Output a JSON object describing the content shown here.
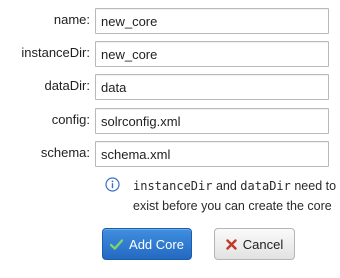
{
  "fields": [
    {
      "label": "name:",
      "value": "new_core"
    },
    {
      "label": "instanceDir:",
      "value": "new_core"
    },
    {
      "label": "dataDir:",
      "value": "data"
    },
    {
      "label": "config:",
      "value": "solrconfig.xml"
    },
    {
      "label": "schema:",
      "value": "schema.xml"
    }
  ],
  "info": {
    "icon": "info-icon",
    "code1": "instanceDir",
    "and": " and ",
    "code2": "dataDir",
    "rest": " need to exist before you can create the core"
  },
  "buttons": {
    "add": {
      "label": "Add Core",
      "icon": "checkmark-icon",
      "icon_color": "#7ed36a"
    },
    "cancel": {
      "label": "Cancel",
      "icon": "x-icon",
      "icon_color": "#c0392b"
    }
  }
}
